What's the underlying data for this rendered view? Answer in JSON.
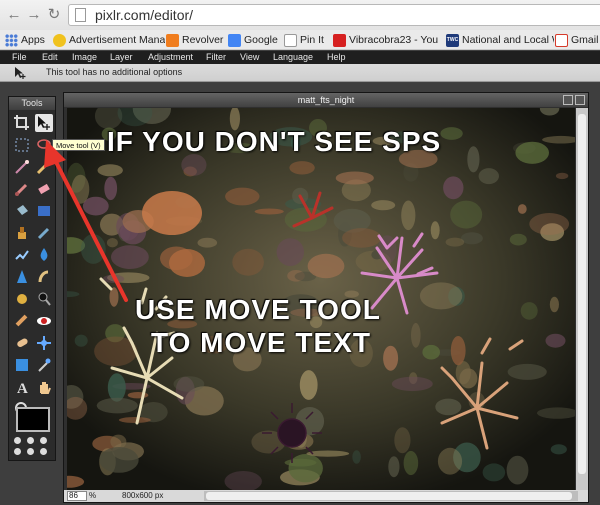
{
  "browser": {
    "url": "pixlr.com/editor/",
    "bookmarks": [
      {
        "label": "Apps",
        "color": "#4a7bd6"
      },
      {
        "label": "Advertisement Mana",
        "color": "#f0c21e"
      },
      {
        "label": "Revolver",
        "color": "#f07d1e"
      },
      {
        "label": "Google",
        "color": "#4285f4"
      },
      {
        "label": "Pin It",
        "color": "#ffffff"
      },
      {
        "label": "Vibracobra23 - You",
        "color": "#d62020"
      },
      {
        "label": "National and Local W",
        "color": "#1f3a7a"
      },
      {
        "label": "Gmail",
        "color": "#d63a2a"
      }
    ],
    "twc_badge": "TWC"
  },
  "menu": {
    "items": [
      "File",
      "Edit",
      "Image",
      "Layer",
      "Adjustment",
      "Filter",
      "View",
      "Language",
      "Help"
    ]
  },
  "options": {
    "text": "This tool has no additional options"
  },
  "tools": {
    "title": "Tools",
    "tooltip": "Move tool (V)",
    "names": [
      "crop-tool",
      "move-tool",
      "marquee-tool",
      "lasso-tool",
      "wand-tool",
      "pencil-tool",
      "brush-tool",
      "eraser-tool",
      "bucket-tool",
      "gradient-tool",
      "clone-tool",
      "color-replace-tool",
      "drawing-tool",
      "blur-tool",
      "sharpen-tool",
      "smudge-tool",
      "sponge-tool",
      "dodge-tool",
      "burn-tool",
      "redeye-tool",
      "spot-heal-tool",
      "bloat-tool",
      "pinch-tool",
      "color-picker-tool",
      "type-tool",
      "hand-tool",
      "zoom-tool"
    ],
    "foreground_color": "#000000"
  },
  "document": {
    "title": "matt_fts_night",
    "zoom": "86",
    "zoom_unit": "%",
    "dimensions": "800x600 px"
  },
  "canvas_text": {
    "line1": "IF YOU DON'T SEE SPS",
    "line2": "USE MOVE TOOL",
    "line3": "TO MOVE TEXT"
  },
  "colors": {
    "arrow": "#e8352b",
    "menu_bg": "#1f1f1f"
  }
}
